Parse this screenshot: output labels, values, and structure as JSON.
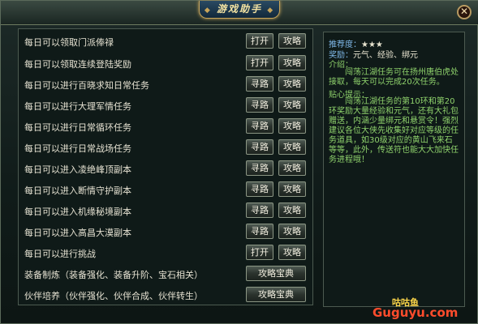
{
  "window": {
    "title": "游戏助手",
    "close_label": "✕"
  },
  "tasks": [
    {
      "label": "每日可以领取门派俸禄",
      "btn1": "打开",
      "btn2": "攻略"
    },
    {
      "label": "每日可以领取连续登陆奖励",
      "btn1": "打开",
      "btn2": "攻略"
    },
    {
      "label": "每日可以进行百晓求知日常任务",
      "btn1": "寻路",
      "btn2": "攻略"
    },
    {
      "label": "每日可以进行大理军情任务",
      "btn1": "寻路",
      "btn2": "攻略"
    },
    {
      "label": "每日可以进行日常循环任务",
      "btn1": "寻路",
      "btn2": "攻略"
    },
    {
      "label": "每日可以进行日常战场任务",
      "btn1": "寻路",
      "btn2": "攻略"
    },
    {
      "label": "每日可以进入凌绝峰顶副本",
      "btn1": "寻路",
      "btn2": "攻略"
    },
    {
      "label": "每日可以进入断情守护副本",
      "btn1": "寻路",
      "btn2": "攻略"
    },
    {
      "label": "每日可以进入机缘秘境副本",
      "btn1": "寻路",
      "btn2": "攻略"
    },
    {
      "label": "每日可以进入高昌大漠副本",
      "btn1": "寻路",
      "btn2": "攻略"
    },
    {
      "label": "每日可以进行挑战",
      "btn1": "打开",
      "btn2": "攻略"
    }
  ],
  "guides": [
    {
      "label": "装备制炼（装备强化、装备升阶、宝石相关）",
      "btn": "攻略宝典"
    },
    {
      "label": "伙伴培养（伙伴强化、伙伴合成、伙伴转生）",
      "btn": "攻略宝典"
    }
  ],
  "detail": {
    "recommend_key": "推荐度：",
    "recommend_val": "★★★",
    "reward_key": "奖励：",
    "reward_val": "元气、经验、绑元",
    "intro_key": "介绍：",
    "intro_text": "闯荡江湖任务可在扬州唐伯虎处接取，每天可以完成20次任务。",
    "tips_key": "贴心提示：",
    "tips_text": "闯荡江湖任务的第10环和第20环奖励大量经验和元气，还有大礼包赠送，内涵少量绑元和悬赏令！强烈建议各位大侠先收集好对应等级的任务道具，如30级对应的黄山飞来石等等，此外，传送符也能大大加快任务进程哦！"
  },
  "watermark": {
    "cn": "咕咕鱼",
    "en": "Guguyu.com"
  }
}
